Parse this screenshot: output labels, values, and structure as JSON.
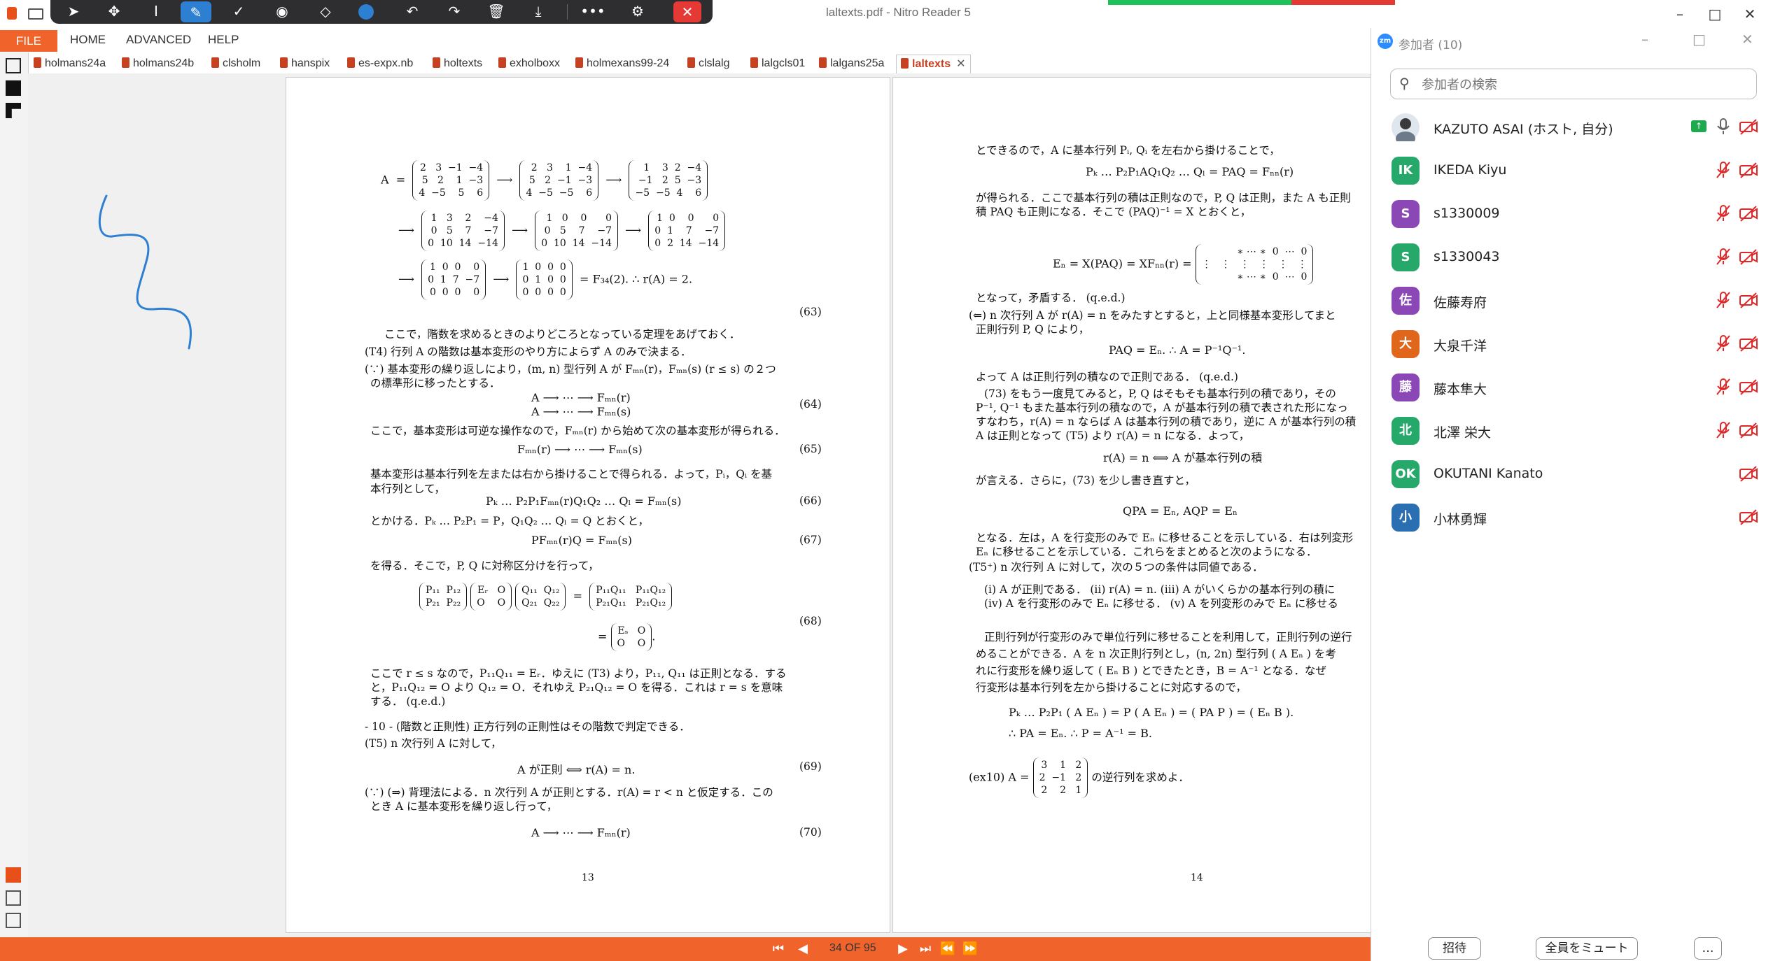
{
  "window": {
    "title": "laltexts.pdf - Nitro Reader 5"
  },
  "menu": {
    "file": "FILE",
    "home": "HOME",
    "advanced": "ADVANCED",
    "help": "HELP"
  },
  "tabs": [
    {
      "label": "holmans24a"
    },
    {
      "label": "holmans24b"
    },
    {
      "label": "clsholm"
    },
    {
      "label": "hanspix"
    },
    {
      "label": "es-expx.nb"
    },
    {
      "label": "holtexts"
    },
    {
      "label": "exholboxx"
    },
    {
      "label": "holmexans99-24"
    },
    {
      "label": "clslalg"
    },
    {
      "label": "lalgcls01"
    },
    {
      "label": "lalgans25a"
    },
    {
      "label": "laltexts",
      "active": true
    }
  ],
  "navigation": {
    "page_indicator": "34 OF 95"
  },
  "page13": {
    "page_number": "13",
    "eq63_label": "(63)",
    "eq63_result": "= F₃₄(2).     ∴  r(A) = 2.",
    "para1": "ここで，階数を求めるときのよりどころとなっている定理をあげておく．",
    "t4": "(T4) 行列 A の階数は基本変形のやり方によらず A のみで決まる．",
    "proof1a": "(∵) 基本変形の繰り返しにより，(m, n) 型行列 A が Fₘₙ(r)，Fₘₙ(s) (r ≤ s) の２つ",
    "proof1b": "の標準形に移ったとする．",
    "eq64a": "A ⟶ ⋯ ⟶ Fₘₙ(r)",
    "eq64b": "A ⟶ ⋯ ⟶ Fₘₙ(s)",
    "eq64_label": "(64)",
    "para2": "ここで，基本変形は可逆な操作なので，Fₘₙ(r) から始めて次の基本変形が得られる．",
    "eq65": "Fₘₙ(r) ⟶ ⋯ ⟶ Fₘₙ(s)",
    "eq65_label": "(65)",
    "para3a": "基本変形は基本行列を左または右から掛けることで得られる．よって，Pᵢ，Qᵢ を基",
    "para3b": "本行列として，",
    "eq66": "Pₖ … P₂P₁Fₘₙ(r)Q₁Q₂ … Qₗ = Fₘₙ(s)",
    "eq66_label": "(66)",
    "para4": "とかける．Pₖ … P₂P₁ = P，Q₁Q₂ … Qₗ = Q とおくと，",
    "eq67": "PFₘₙ(r)Q = Fₘₙ(s)",
    "eq67_label": "(67)",
    "para5": "を得る．そこで，P, Q に対称区分けを行って，",
    "eq68_label": "(68)",
    "para6a": "ここで r ≤ s なので，P₁₁Q₁₁ = Eᵣ．ゆえに (T3) より，P₁₁, Q₁₁ は正則となる．する",
    "para6b": "と，P₁₁Q₁₂ = O より Q₁₂ = O．それゆえ P₂₁Q₁₂ = O を得る．これは r = s を意味",
    "para6c": "する． (q.e.d.)",
    "sec10": "- 10 - (階数と正則性) 正方行列の正則性はその階数で判定できる．",
    "t5": "(T5) n 次行列 A に対して，",
    "eq69": "A が正則  ⟺  r(A) = n.",
    "eq69_label": "(69)",
    "proof2a": "(∵) (⇒) 背理法による．n 次行列 A が正則とする．r(A) = r < n と仮定する．この",
    "proof2b": "とき A に基本変形を繰り返し行って，",
    "eq70": "A ⟶ ⋯ ⟶ Fₘₙ(r)",
    "eq70_label": "(70)"
  },
  "page14": {
    "page_number": "14",
    "l1": "とできるので，A に基本行列 Pᵢ, Qᵢ を左右から掛けることで，",
    "eq_a": "Pₖ … P₂P₁AQ₁Q₂ … Qₗ = PAQ = Fₙₙ(r)",
    "l2": "が得られる．ここで基本行列の積は正則なので，P, Q は正則，また A も正則",
    "l3": "積 PAQ も正則になる．そこで (PAQ)⁻¹ = X とおくと，",
    "eq_b": "Eₙ = X(PAQ) = XFₙₙ(r) =",
    "l4": "となって，矛盾する． (q.e.d.)",
    "l5": "(⇐) n 次行列 A が r(A) = n をみたすとすると，上と同様基本変形してまと",
    "l6": "正則行列 P, Q により，",
    "eq_c": "PAQ = Eₙ.      ∴  A = P⁻¹Q⁻¹.",
    "l7": "よって A は正則行列の積なので正則である． (q.e.d.)",
    "l8": "(73) をもう一度見てみると，P, Q はそもそも基本行列の積であり，その",
    "l9": "P⁻¹, Q⁻¹ もまた基本行列の積なので，A が基本行列の積で表された形になっ",
    "l10": "すなわち，r(A) = n ならば A は基本行列の積であり，逆に A が基本行列の積",
    "l11": "A は正則となって (T5) より r(A) = n になる．よって，",
    "eq_d": "r(A) = n  ⟺  A が基本行列の積",
    "l12": "が言える．さらに，(73) を少し書き直すと，",
    "eq_e": "QPA = Eₙ,       AQP = Eₙ",
    "l13": "となる．左は，A を行変形のみで Eₙ に移せることを示している．右は列変形",
    "l14": "Eₙ に移せることを示している．これらをまとめると次のようになる．",
    "l15": "(T5⁺) n 次行列 A に対して，次の５つの条件は同値である．",
    "l16": "(i) A が正則である． (ii) r(A) = n.  (iii) A がいくらかの基本行列の積に",
    "l17": "(iv) A を行変形のみで Eₙ に移せる． (v) A を列変形のみで Eₙ に移せる",
    "l18": "正則行列が行変形のみで単位行列に移せることを利用して，正則行列の逆行",
    "l19": "めることができる．A を n 次正則行列とし，(n, 2n) 型行列 ( A  Eₙ ) を考",
    "l20": "れに行変形を繰り返して ( Eₙ  B ) とできたとき，B = A⁻¹ となる．なぜ",
    "l21": "行変形は基本行列を左から掛けることに対応するので，",
    "eq_f": "Pₖ … P₂P₁ ( A  Eₙ ) = P ( A  Eₙ ) = ( PA  P ) = ( Eₙ  B ).",
    "eq_g": "∴  PA = Eₙ.      ∴  P = A⁻¹ = B.",
    "ex10_pre": "(ex10) A =",
    "ex10_post": "の逆行列を求めよ．"
  },
  "participants": {
    "title": "参加者 (10)",
    "search_placeholder": "参加者の検索",
    "list": [
      {
        "name": "KAZUTO ASAI (ホスト, 自分)",
        "initials": "",
        "color": "#e9e9e9",
        "mic": "on",
        "video": "off",
        "sharing": true
      },
      {
        "name": "IKEDA Kiyu",
        "initials": "IK",
        "color": "#27a86b",
        "mic": "muted",
        "video": "off"
      },
      {
        "name": "s1330009",
        "initials": "S",
        "color": "#8a47b5",
        "mic": "muted",
        "video": "off"
      },
      {
        "name": "s1330043",
        "initials": "S",
        "color": "#27a86b",
        "mic": "muted",
        "video": "off"
      },
      {
        "name": "佐藤寿府",
        "initials": "佐",
        "color": "#8a47b5",
        "mic": "muted",
        "video": "off"
      },
      {
        "name": "大泉千洋",
        "initials": "大",
        "color": "#e0661c",
        "mic": "muted",
        "video": "off"
      },
      {
        "name": "藤本隼大",
        "initials": "藤",
        "color": "#8a47b5",
        "mic": "muted",
        "video": "off"
      },
      {
        "name": "北澤  栄大",
        "initials": "北",
        "color": "#27a86b",
        "mic": "muted",
        "video": "off"
      },
      {
        "name": "OKUTANI Kanato",
        "initials": "OK",
        "color": "#27a86b",
        "mic": "none",
        "video": "off"
      },
      {
        "name": "小林勇輝",
        "initials": "小",
        "color": "#2b6fb3",
        "mic": "none",
        "video": "off"
      }
    ],
    "invite": "招待",
    "mute_all": "全員をミュート",
    "more": "…"
  },
  "icons": {
    "toolbar": [
      "pointer-icon",
      "move-icon",
      "text-cursor-icon",
      "pen-icon",
      "check-icon",
      "stamp-icon",
      "eraser-icon",
      "color-dot-icon",
      "undo-icon",
      "redo-icon",
      "trash-icon",
      "download-icon",
      "more-icon",
      "share-icon",
      "close-icon"
    ]
  },
  "colors": {
    "accent": "#f0642c",
    "annotation": "#2d7fd2",
    "pen_active": "#2d7fd2"
  }
}
